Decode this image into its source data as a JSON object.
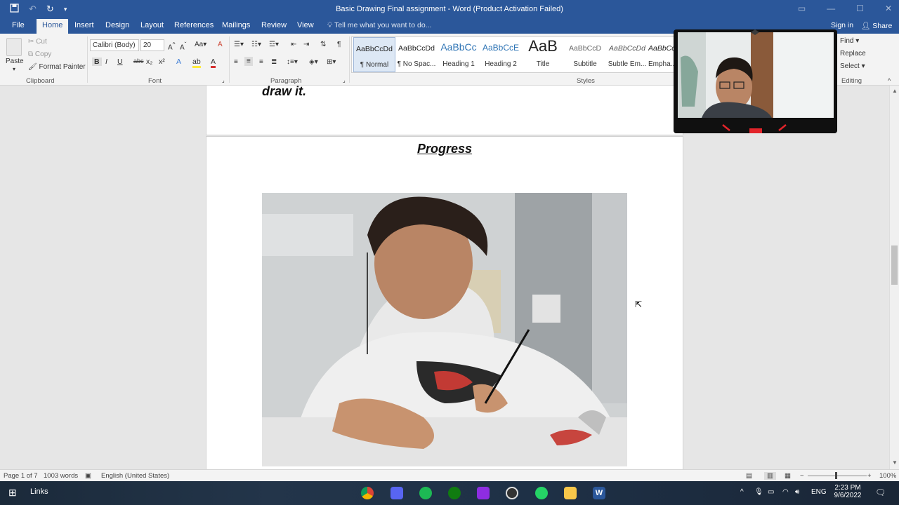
{
  "titlebar": {
    "title": "Basic Drawing Final assignment - Word (Product Activation Failed)",
    "qat": [
      "save-icon",
      "undo-icon",
      "redo-icon",
      "customize-icon"
    ]
  },
  "tabs": {
    "file": "File",
    "home": "Home",
    "insert": "Insert",
    "design": "Design",
    "layout": "Layout",
    "references": "References",
    "mailings": "Mailings",
    "review": "Review",
    "view": "View",
    "tell_me": "Tell me what you want to do...",
    "sign_in": "Sign in",
    "share": "Share"
  },
  "clipboard": {
    "paste": "Paste",
    "cut": "Cut",
    "copy": "Copy",
    "format_painter": "Format Painter",
    "label": "Clipboard"
  },
  "font": {
    "name": "Calibri (Body)",
    "size": "20",
    "label": "Font"
  },
  "paragraph": {
    "label": "Paragraph"
  },
  "styles": {
    "label": "Styles",
    "items": [
      {
        "sample": "AaBbCcDd",
        "name": "¶ Normal"
      },
      {
        "sample": "AaBbCcDd",
        "name": "¶ No Spac..."
      },
      {
        "sample": "AaBbCc",
        "name": "Heading 1"
      },
      {
        "sample": "AaBbCcE",
        "name": "Heading 2"
      },
      {
        "sample": "AaB",
        "name": "Title"
      },
      {
        "sample": "AaBbCcD",
        "name": "Subtitle"
      },
      {
        "sample": "AaBbCcDd",
        "name": "Subtle Em..."
      },
      {
        "sample": "AaBbCc",
        "name": "Empha..."
      }
    ]
  },
  "editing": {
    "find": "Find",
    "replace": "Replace",
    "select": "Select",
    "label": "Editing"
  },
  "document": {
    "previous_page_text": "draw it.",
    "heading": "Progress"
  },
  "statusbar": {
    "page": "Page 1 of 7",
    "words": "1003 words",
    "language": "English (United States)",
    "zoom": "100%"
  },
  "taskbar": {
    "links": "Links",
    "time": "2:23 PM",
    "date": "9/6/2022",
    "lang": "ENG"
  },
  "colors": {
    "word_blue": "#2b579a",
    "ribbon_bg": "#f3f3f3",
    "doc_bg": "#e6e6e6"
  }
}
